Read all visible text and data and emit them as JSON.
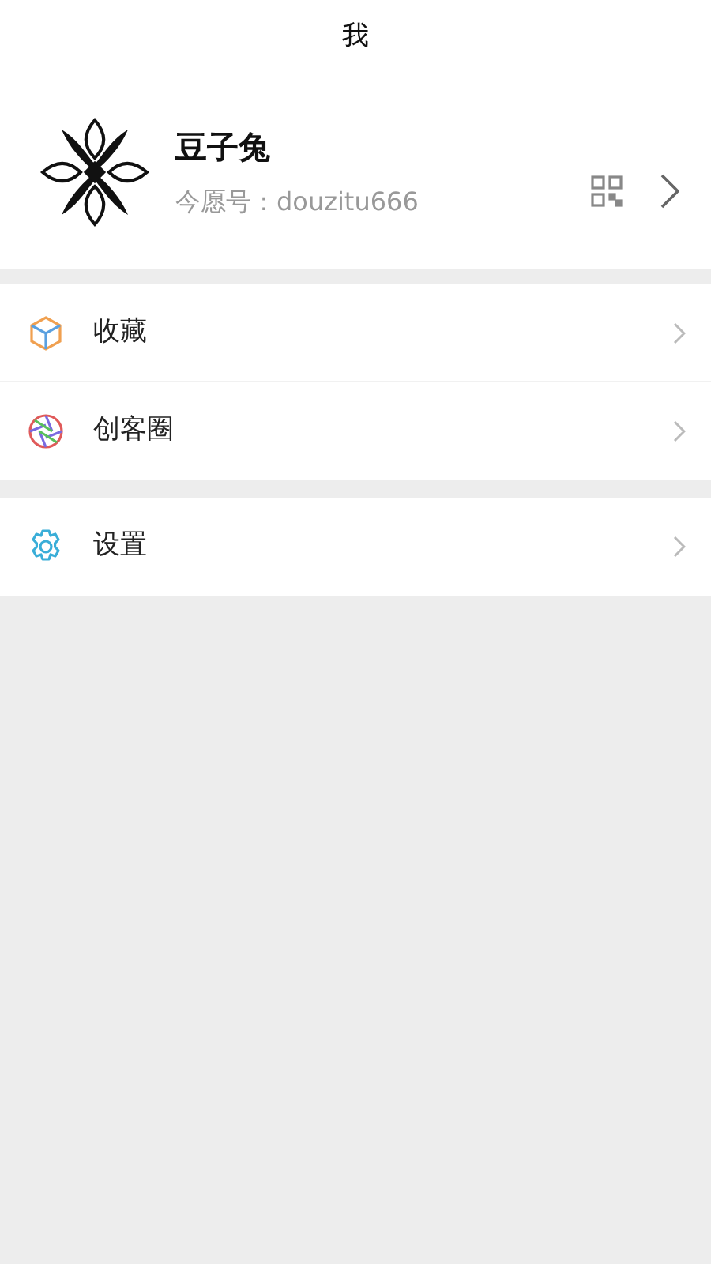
{
  "header": {
    "title": "我"
  },
  "profile": {
    "name": "豆子兔",
    "account": "今愿号：douzitu666"
  },
  "menu_groups": [
    {
      "items": [
        {
          "kind": "box",
          "label": "收藏"
        },
        {
          "kind": "aperture",
          "label": "创客圈"
        }
      ]
    },
    {
      "items": [
        {
          "kind": "gear",
          "label": "设置"
        }
      ]
    }
  ]
}
